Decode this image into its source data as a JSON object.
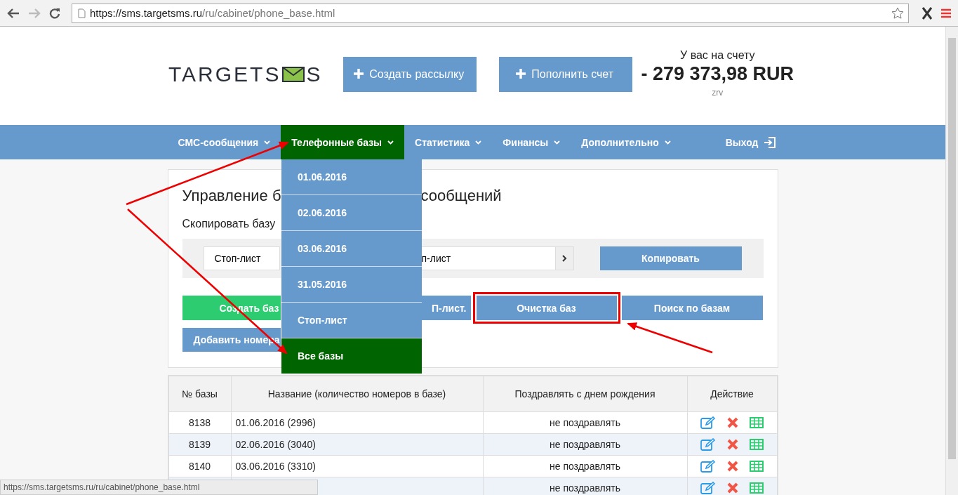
{
  "browser": {
    "url_host": "https://sms.targetsms.ru",
    "url_path": "/ru/cabinet/phone_base.html"
  },
  "header": {
    "logo_left": "TARGETS",
    "logo_right": "S",
    "buttons": [
      "Создать рассылку",
      "Пополнить счет"
    ],
    "balance_label": "У вас на счету",
    "balance": "- 279 373,98 RUR",
    "user": "zrv"
  },
  "nav": {
    "items": [
      {
        "label": "СМС-сообщения",
        "selected": false
      },
      {
        "label": "Телефонные базы",
        "selected": true
      },
      {
        "label": "Статистика",
        "selected": false
      },
      {
        "label": "Финансы",
        "selected": false
      },
      {
        "label": "Дополнительно",
        "selected": false
      }
    ],
    "logout": "Выход"
  },
  "dropdown": [
    {
      "label": "01.06.2016",
      "selected": false
    },
    {
      "label": "02.06.2016",
      "selected": false
    },
    {
      "label": "03.06.2016",
      "selected": false
    },
    {
      "label": "31.05.2016",
      "selected": false
    },
    {
      "label": "Стоп-лист",
      "selected": false
    },
    {
      "label": "Все базы",
      "selected": true
    }
  ],
  "card": {
    "title_left": "Управление б",
    "title_right": "сообщений",
    "copy_label": "Скопировать базу",
    "select_from": "Стоп-лист",
    "select_to": "п-лист",
    "copy_button": "Копировать",
    "actions": [
      {
        "label": "Создать баз",
        "kind": "green",
        "highlighted": false
      },
      {
        "label": "П-лист.",
        "kind": "blue",
        "highlighted": false
      },
      {
        "label": "Очистка баз",
        "kind": "blue",
        "highlighted": true
      },
      {
        "label": "Поиск по базам",
        "kind": "blue",
        "highlighted": false
      }
    ],
    "add_button": "Добавить номера"
  },
  "table": {
    "columns": [
      "№ базы",
      "Название (количество номеров в базе)",
      "Поздравлять с днем рождения",
      "Действие"
    ],
    "rows": [
      {
        "number": "8138",
        "name": "01.06.2016 (2996)",
        "birthday": "не поздравлять"
      },
      {
        "number": "8139",
        "name": "02.06.2016 (3040)",
        "birthday": "не поздравлять"
      },
      {
        "number": "8140",
        "name": "03.06.2016 (3310)",
        "birthday": "не поздравлять"
      },
      {
        "number": "",
        "name": "",
        "birthday": "не поздравлять"
      }
    ]
  },
  "status_bar": "https://sms.targetsms.ru/ru/cabinet/phone_base.html"
}
